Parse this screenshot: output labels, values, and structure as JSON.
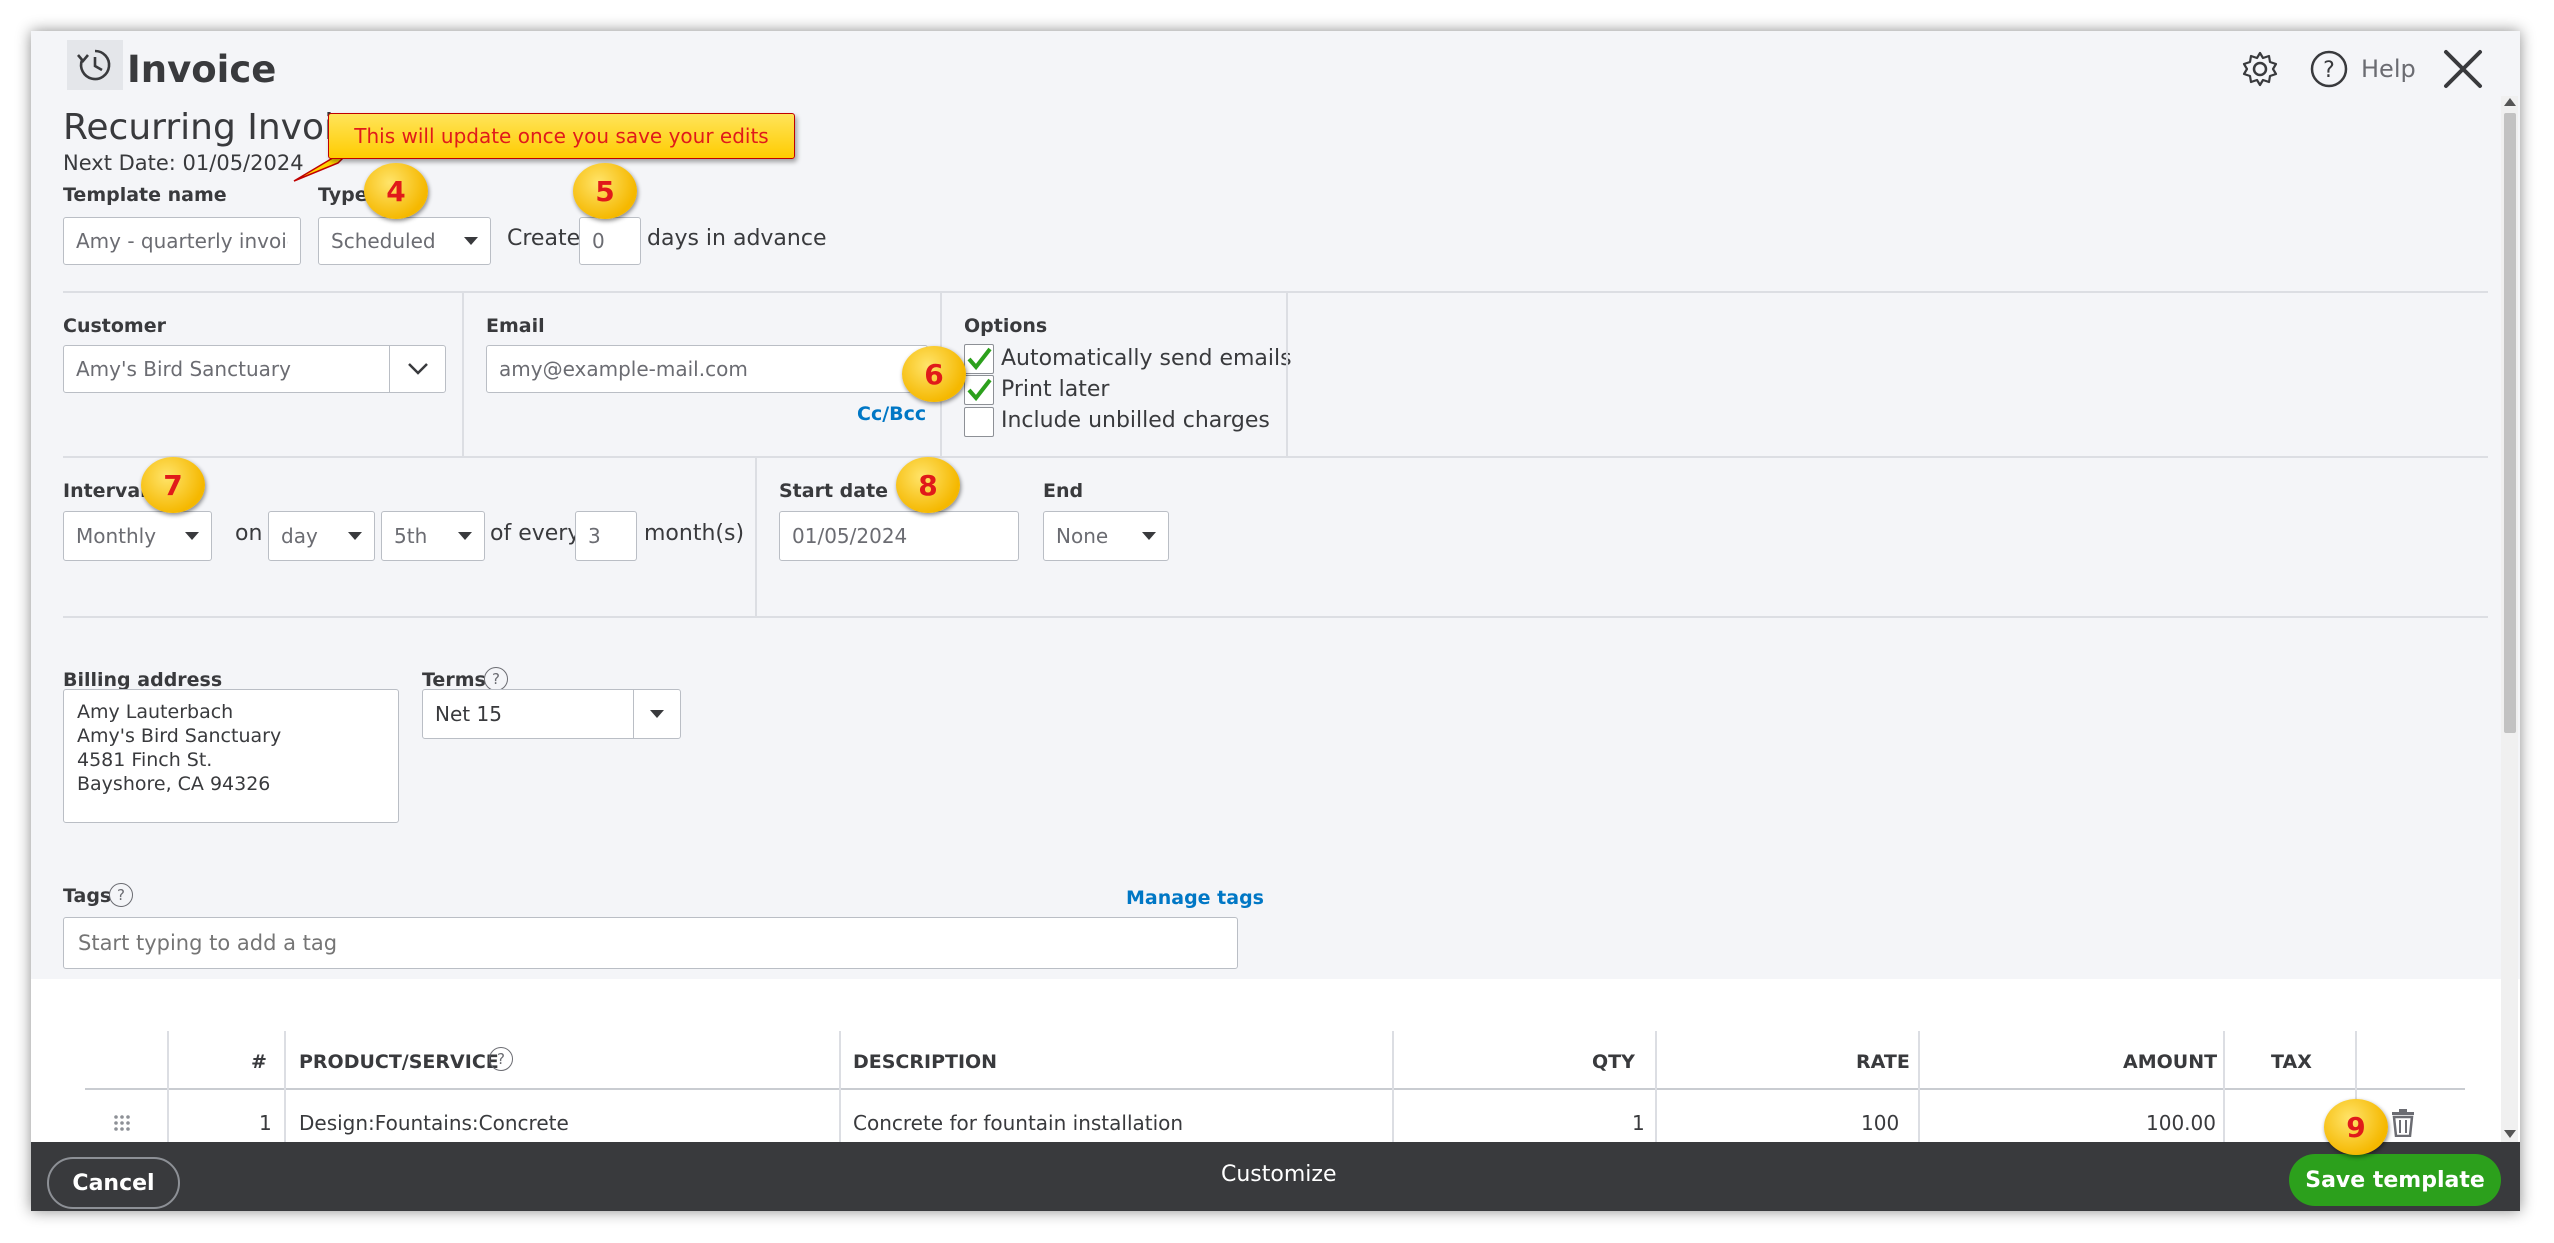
{
  "header": {
    "title": "Invoice",
    "help_label": "Help"
  },
  "page": {
    "heading": "Recurring Invoic",
    "next_date": "Next Date: 01/05/2024",
    "callout": "This will update once you save your edits"
  },
  "template": {
    "name_label": "Template name",
    "name_value": "Amy - quarterly invoice",
    "type_label": "Type",
    "type_value": "Scheduled",
    "create_label": "Create",
    "days_value": "0",
    "days_suffix": "days in advance"
  },
  "customer": {
    "label": "Customer",
    "value": "Amy's Bird Sanctuary"
  },
  "email": {
    "label": "Email",
    "value": "amy@example-mail.com",
    "ccbcc": "Cc/Bcc"
  },
  "options": {
    "label": "Options",
    "items": [
      {
        "label": "Automatically send emails",
        "checked": true
      },
      {
        "label": "Print later",
        "checked": true
      },
      {
        "label": "Include unbilled charges",
        "checked": false
      }
    ]
  },
  "interval": {
    "label": "Interval",
    "frequency": "Monthly",
    "on_label": "on",
    "unit": "day",
    "day": "5th",
    "of_every_label": "of every",
    "every_value": "3",
    "months_label": "month(s)"
  },
  "dates": {
    "start_label": "Start date",
    "start_value": "01/05/2024",
    "end_label": "End",
    "end_value": "None"
  },
  "billing": {
    "label": "Billing address",
    "lines": [
      "Amy Lauterbach",
      "Amy's Bird Sanctuary",
      "4581 Finch St.",
      "Bayshore, CA  94326"
    ]
  },
  "terms": {
    "label": "Terms",
    "value": "Net 15"
  },
  "tags": {
    "label": "Tags",
    "manage": "Manage tags",
    "placeholder": "Start typing to add a tag"
  },
  "table": {
    "headers": [
      "#",
      "PRODUCT/SERVICE",
      "DESCRIPTION",
      "QTY",
      "RATE",
      "AMOUNT",
      "TAX"
    ],
    "rows": [
      {
        "num": "1",
        "product": "Design:Fountains:Concrete",
        "description": "Concrete for fountain installation",
        "qty": "1",
        "rate": "100",
        "amount": "100.00",
        "tax": ""
      }
    ]
  },
  "footer": {
    "cancel": "Cancel",
    "customize": "Customize",
    "save": "Save template"
  },
  "badges": [
    "4",
    "5",
    "6",
    "7",
    "8",
    "9"
  ],
  "colors": {
    "accent_green": "#2ca01c",
    "link_blue": "#0077c5",
    "footer_bg": "#393a3d",
    "badge_yellow": "#f5b800",
    "badge_text": "#e01a1a",
    "callout_bg": "#ffd400"
  }
}
